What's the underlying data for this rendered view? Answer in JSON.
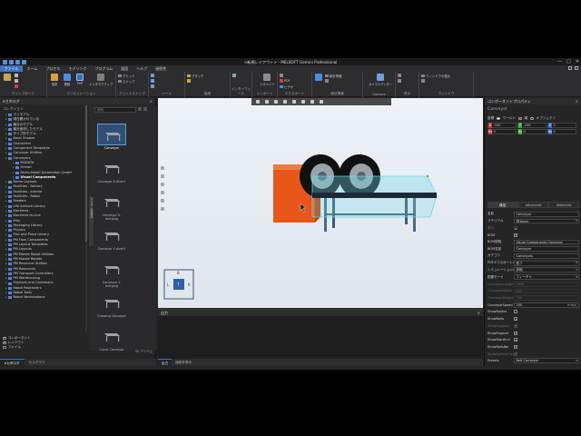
{
  "titlebar": {
    "title": "<新規レイアウト> - MELSOFT Gemini Professional",
    "minimize": "—",
    "maximize": "□",
    "close": "✕"
  },
  "menu": [
    "ファイル",
    "ホーム",
    "プロセス",
    "モデリング",
    "プログラム",
    "図面",
    "ヘルプ",
    "接続性"
  ],
  "ribbon": {
    "groups": {
      "clipboard": "クリップボード",
      "manipulation": "マニピュレーション",
      "grid_snap": "グリッドスナップ",
      "tools": "ツール",
      "connect": "接続",
      "interface": "インターフェース",
      "import": "インポート",
      "export": "エクスポート",
      "stats": "統計情報",
      "camera": "Camera",
      "display": "表示",
      "window": "ウィンドウ"
    },
    "buttons": {
      "select": "選択",
      "move": "移動",
      "pnp": "PnP",
      "interactive": "インタラクティブ",
      "grid": "グリッド",
      "snap": "スナップ",
      "attach": "アタッチ",
      "interface_lines": "インターフェース",
      "geometry": "ジオメトリ",
      "pdf": "PDF",
      "video": "ビデオ",
      "stats_item": "統計情報",
      "camera_editor": "カメラエディター",
      "window_restore": "ウィンドウの復元"
    }
  },
  "left_panel": {
    "title": "eカタログ",
    "section_label": "コレクション",
    "tree": [
      {
        "label": "マイモデル",
        "level": 1
      },
      {
        "label": "現在開かれている",
        "level": 1
      },
      {
        "label": "最近のモデル",
        "level": 1
      },
      {
        "label": "最近使用したモデル",
        "level": 1
      },
      {
        "label": "タイプ別モデル",
        "level": 1
      },
      {
        "label": "Basic Shapes",
        "level": 1
      },
      {
        "label": "Characters",
        "level": 1
      },
      {
        "label": "Component Templates",
        "level": 1
      },
      {
        "label": "Conveyor Utilities",
        "level": 1
      },
      {
        "label": "Conveyors",
        "level": 1
      },
      {
        "label": "MVDATA",
        "level": 2
      },
      {
        "label": "Omron",
        "level": 2
      },
      {
        "label": "Rhein-Nadel Automation GmbH",
        "level": 2
      },
      {
        "label": "Visual Components",
        "level": 2,
        "selected": true
      },
      {
        "label": "Demo Layouts",
        "level": 1
      },
      {
        "label": "Facilities - Factory",
        "level": 1
      },
      {
        "label": "Facilities - Interior",
        "level": 1
      },
      {
        "label": "Facilities - Robot",
        "level": 1
      },
      {
        "label": "Feeders",
        "level": 1
      },
      {
        "label": "Life Science Library",
        "level": 1
      },
      {
        "label": "Machines",
        "level": 1
      },
      {
        "label": "Machines In-Line",
        "level": 1
      },
      {
        "label": "Misc",
        "level": 1
      },
      {
        "label": "Packaging Library",
        "level": 1
      },
      {
        "label": "Physics",
        "level": 1
      },
      {
        "label": "Pick and Place Library",
        "level": 1
      },
      {
        "label": "PM Flow Components",
        "level": 1
      },
      {
        "label": "PM Layout Templates",
        "level": 1
      },
      {
        "label": "PM Layouts",
        "level": 1
      },
      {
        "label": "PM Mobile Robot Utilities",
        "level": 1
      },
      {
        "label": "PM Mobile Robots",
        "level": 1
      },
      {
        "label": "PM Resource Utilities",
        "level": 1
      },
      {
        "label": "PM Resources",
        "level": 1
      },
      {
        "label": "PM Transport Controllers",
        "level": 1
      },
      {
        "label": "PM Warehousing",
        "level": 1
      },
      {
        "label": "Products and Containers",
        "level": 1
      },
      {
        "label": "Robot Positioners",
        "level": 1
      },
      {
        "label": "Robot Tools",
        "level": 1
      },
      {
        "label": "Robot Workstations",
        "level": 1
      }
    ],
    "checks": [
      {
        "label": "コンポーネント",
        "on": true
      },
      {
        "label": "レイアウト",
        "on": true
      },
      {
        "label": "ファイル",
        "on": false
      }
    ],
    "search_placeholder": "検索",
    "items": [
      {
        "label": "Conveyor",
        "selected": true
      },
      {
        "label": "Conveyor X-diver1"
      },
      {
        "label": "Conveyor X-merging"
      },
      {
        "label": "Conveyor Y-diver1"
      },
      {
        "label": "Conveyor Y-merging"
      },
      {
        "label": "Crossing Conveyor"
      },
      {
        "label": "Curve Conveyor"
      }
    ],
    "item_count": "35 アイテム",
    "vertical_tab": "アイテムを表示",
    "tabs": [
      "eカタログ",
      "セルグラフ"
    ]
  },
  "viewport": {
    "axis_labels": [
      "B",
      "L",
      "T",
      "R"
    ]
  },
  "output": {
    "title": "出力",
    "tabs": [
      "出力",
      "接続非表示"
    ]
  },
  "properties": {
    "title": "コンポーネントプロパティ",
    "object_name": "Conveyor",
    "coord_label": "座標",
    "coord_world": "ワールド",
    "coord_parent": "親",
    "coord_object": "オブジェクト",
    "xyz1": [
      {
        "tag": "X",
        "val": "-500"
      },
      {
        "tag": "Y",
        "val": "-200"
      },
      {
        "tag": "Z",
        "val": "0"
      }
    ],
    "xyz2": [
      {
        "tag": "Rx",
        "val": "0"
      },
      {
        "tag": "Ry",
        "val": "0"
      },
      {
        "tag": "Rz",
        "val": "0"
      }
    ],
    "tabs": [
      "既定",
      "Advanced",
      "Materials"
    ],
    "rows": [
      {
        "label": "名前",
        "value": "Conveyor",
        "type": "text"
      },
      {
        "label": "マテリアル",
        "value": "black",
        "type": "dd",
        "swatch": true
      },
      {
        "label": "表示",
        "type": "cb",
        "on": true,
        "dim": true
      },
      {
        "label": "BOM",
        "type": "cb",
        "on": true
      },
      {
        "label": "BOM説明",
        "value": "Visual Components Conveyor",
        "type": "text"
      },
      {
        "label": "BOM名前",
        "value": "Conveyor",
        "type": "text"
      },
      {
        "label": "カテゴリ",
        "value": "Conveyors",
        "type": "text"
      },
      {
        "label": "PDFエクスポートレ...",
        "value": "低フ",
        "type": "dd"
      },
      {
        "label": "シミュレーションレ...",
        "value": "詳細",
        "type": "dd"
      },
      {
        "label": "配置モード",
        "value": "フィーチャ",
        "type": "dd"
      },
      {
        "label": "ConveyorLength",
        "value": "1500",
        "type": "text",
        "dim": true
      },
      {
        "label": "ConveyorWidth",
        "value": "500",
        "type": "text",
        "dim": true
      },
      {
        "label": "ConveyorHeight",
        "value": "700",
        "type": "text",
        "dim": true
      },
      {
        "label": "ConveyorSpeed",
        "value": "200",
        "unit": "mm/s",
        "type": "text"
      },
      {
        "label": "ShowRollers",
        "type": "cb",
        "on": false
      },
      {
        "label": "ShowBelts",
        "type": "cb",
        "on": true
      },
      {
        "label": "ShowSupport",
        "type": "cb",
        "on": true,
        "dim": true
      },
      {
        "label": "ShowSupport",
        "type": "cb",
        "on": true
      },
      {
        "label": "ShowStartEnd",
        "type": "cb",
        "on": true
      },
      {
        "label": "ShowRailsBar",
        "type": "cb",
        "on": true
      },
      {
        "label": "ShowBottomCover",
        "type": "cb",
        "on": true,
        "dim": true
      },
      {
        "label": "Presets",
        "value": "Belt Conveyor",
        "type": "dd"
      }
    ]
  },
  "colors": {
    "accent": "#3f70c0",
    "conveyor_highlight": "#6fd6e6",
    "box_orange": "#e8561a",
    "support": "#4a6b80"
  }
}
